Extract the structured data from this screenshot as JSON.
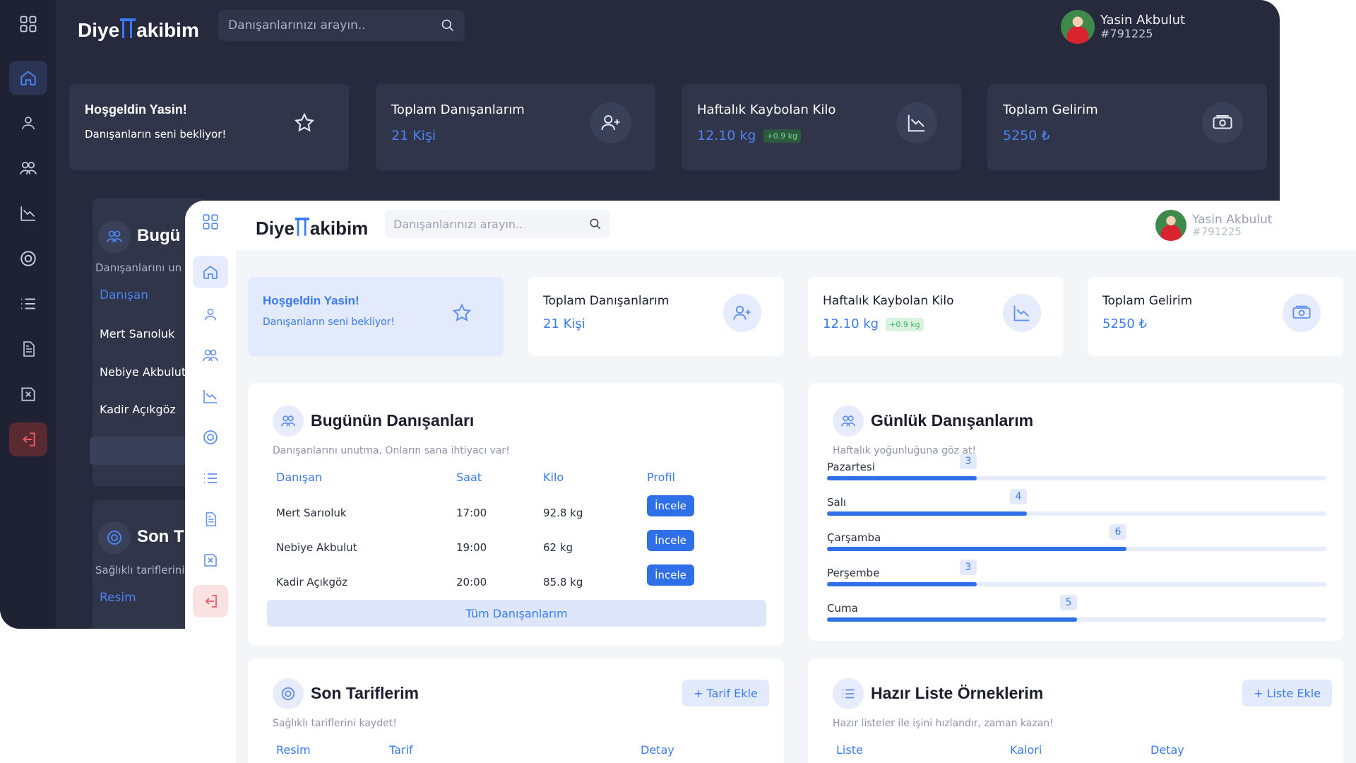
{
  "app": {
    "logo_before": "Diye",
    "logo_after": "akibim",
    "search_placeholder": "Danışanlarınızı arayın..",
    "user": {
      "name": "Yasin Akbulut",
      "id": "#791225"
    }
  },
  "cards": {
    "welcome": {
      "title": "Hoşgeldin Yasin!",
      "subtitle": "Danışanların seni bekliyor!"
    },
    "clients": {
      "title": "Toplam Danışanlarım",
      "value": "21 Kişi"
    },
    "weight": {
      "title": "Haftalık Kaybolan Kilo",
      "value": "12.10 kg",
      "badge": "+0.9 kg"
    },
    "income": {
      "title": "Toplam Gelirim",
      "value": "5250 ₺"
    }
  },
  "today": {
    "title": "Bugünün Danışanları",
    "subtitle": "Danışanlarını unutma, Onların sana ihtiyacı var!",
    "headers": [
      "Danışan",
      "Saat",
      "Kilo",
      "Profil"
    ],
    "rows": [
      {
        "name": "Mert Sarıoluk",
        "time": "17:00",
        "weight": "92.8 kg",
        "action": "İncele"
      },
      {
        "name": "Nebiye Akbulut",
        "time": "19:00",
        "weight": "62 kg",
        "action": "İncele"
      },
      {
        "name": "Kadir Açıkgöz",
        "time": "20:00",
        "weight": "85.8 kg",
        "action": "İncele"
      }
    ],
    "all_button": "Tüm Danışanlarım"
  },
  "daily": {
    "title": "Günlük Danışanlarım",
    "subtitle": "Haftalık yoğunluğuna göz at!",
    "max_value": 10,
    "bars": [
      {
        "day": "Pazartesi",
        "value": 3
      },
      {
        "day": "Salı",
        "value": 4
      },
      {
        "day": "Çarşamba",
        "value": 6
      },
      {
        "day": "Perşembe",
        "value": 3
      },
      {
        "day": "Cuma",
        "value": 5
      }
    ]
  },
  "recipes": {
    "title": "Son Tariflerim",
    "subtitle": "Sağlıklı tariflerini kaydet!",
    "add_button": "+ Tarif Ekle",
    "headers": [
      "Resim",
      "Tarif",
      "Detay"
    ]
  },
  "lists": {
    "title": "Hazır Liste Örneklerim",
    "subtitle": "Hazır listeler ile işini hızlandır, zaman kazan!",
    "add_button": "+ Liste Ekle",
    "headers": [
      "Liste",
      "Kalori",
      "Detay"
    ]
  },
  "dark_partial": {
    "today_title": "Bugü",
    "today_sub": "Danışanlarını un",
    "recipes_title": "Son T",
    "recipes_sub": "Sağlıklı tariflerini"
  },
  "icons": [
    "grid-icon",
    "home-icon",
    "user-icon",
    "users-icon",
    "chart-icon",
    "recipe-icon",
    "list-icon",
    "document-icon",
    "close-square-icon",
    "logout-icon",
    "search-icon",
    "star-icon",
    "user-plus-icon",
    "trend-down-icon",
    "money-icon"
  ],
  "colors": {
    "accent": "#3a7af5",
    "dark_bg": "#262a3c",
    "dark_panel": "#30354a",
    "light_bg": "#f4f5f9",
    "logout": "#ef5b64",
    "badge_green": "#3bb35c"
  }
}
